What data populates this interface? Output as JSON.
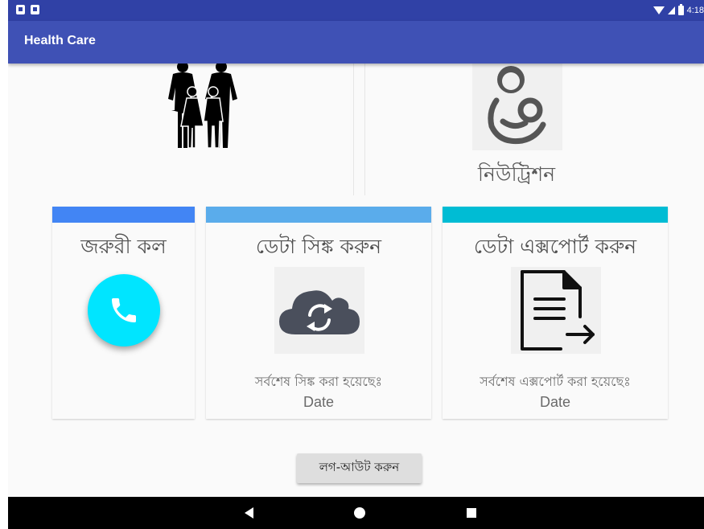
{
  "status_bar": {
    "time": "4:18",
    "icons": [
      "sim-icon",
      "notification-icon",
      "wifi-icon",
      "signal-icon",
      "battery-icon"
    ]
  },
  "app_bar": {
    "title": "Health Care",
    "color": "#3f51b5"
  },
  "top_cards": {
    "family": {
      "icon": "family-icon"
    },
    "nutrition": {
      "icon": "mother-baby-icon",
      "label": "নিউট্রিশন"
    }
  },
  "cards": {
    "emergency": {
      "title": "জরুরী কল",
      "accent": "#4285f4",
      "icon": "phone-icon",
      "button_color": "#00e5ff"
    },
    "sync": {
      "title": "ডেটা সিঙ্ক করুন",
      "accent": "#5aaceb",
      "icon": "cloud-sync-icon",
      "last_label": "সর্বশেষ সিঙ্ক করা হয়েছেঃ",
      "last_value": "Date"
    },
    "export": {
      "title": "ডেটা এক্সপোর্ট করুন",
      "accent": "#00bcd4",
      "icon": "document-export-icon",
      "last_label": "সর্বশেষ এক্সপোর্ট করা হয়েছেঃ",
      "last_value": "Date"
    }
  },
  "logout": {
    "label": "লগ-আউট করুন"
  },
  "nav_bar": {
    "icons": [
      "back-icon",
      "home-icon",
      "recents-icon"
    ]
  }
}
